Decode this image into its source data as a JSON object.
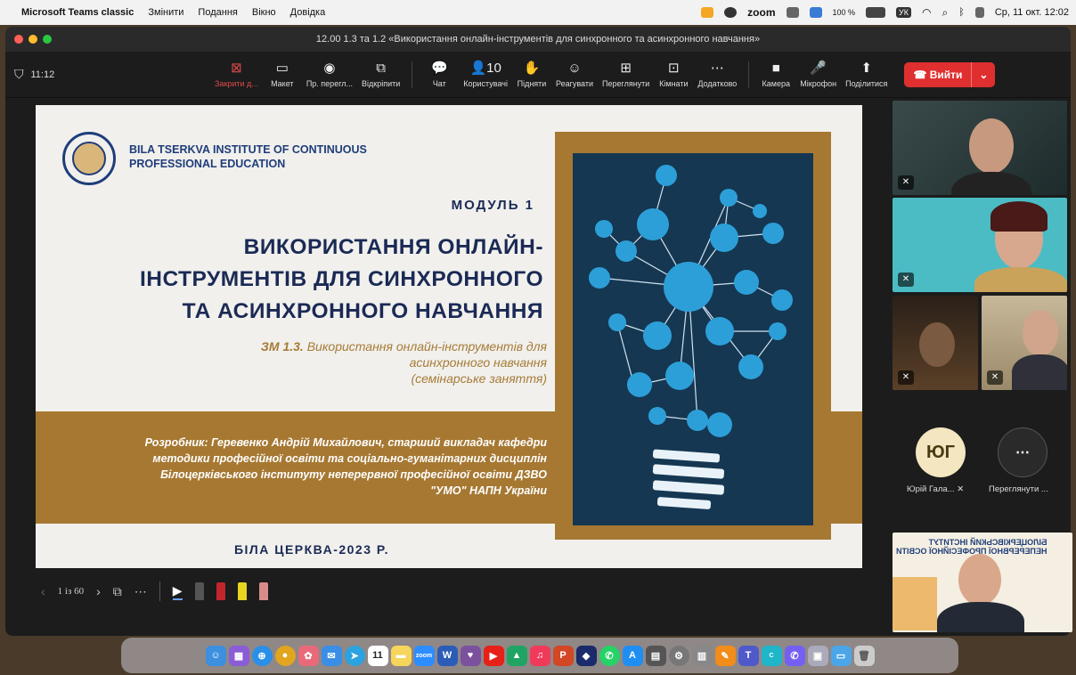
{
  "menubar": {
    "app": "Microsoft Teams classic",
    "items": [
      "Змінити",
      "Подання",
      "Вікно",
      "Довідка"
    ],
    "zoom": "zoom",
    "battery": "100 %",
    "lang": "УК",
    "datetime": "Ср, 11 окт.  12:02"
  },
  "window": {
    "title": "12.00 1.3 та 1.2 «Використання онлайн-інструментів для синхронного та асинхронного навчання»"
  },
  "toolbar": {
    "timer": "11:12",
    "buttons": [
      {
        "name": "stop-presenting",
        "icon": "⊠",
        "label": "Закрити д..."
      },
      {
        "name": "layout",
        "icon": "▭",
        "label": "Макет"
      },
      {
        "name": "presenter-view",
        "icon": "◉",
        "label": "Пр. перегл..."
      },
      {
        "name": "pop-out",
        "icon": "⧉",
        "label": "Відкріпити"
      },
      {
        "name": "chat",
        "icon": "💬",
        "label": "Чат"
      },
      {
        "name": "people",
        "icon": "👤10",
        "label": "Користувачі"
      },
      {
        "name": "raise",
        "icon": "✋",
        "label": "Підняти"
      },
      {
        "name": "react",
        "icon": "☺",
        "label": "Реагувати"
      },
      {
        "name": "view",
        "icon": "⊞",
        "label": "Переглянути"
      },
      {
        "name": "rooms",
        "icon": "⊡",
        "label": "Кімнати"
      },
      {
        "name": "more",
        "icon": "⋯",
        "label": "Додатково"
      },
      {
        "name": "camera",
        "icon": "■",
        "label": "Камера"
      },
      {
        "name": "mic",
        "icon": "🎤",
        "label": "Мікрофон"
      },
      {
        "name": "share",
        "icon": "⬆",
        "label": "Поділитися"
      }
    ],
    "leave": "Вийти"
  },
  "slide": {
    "institute": "BILA TSERKVA INSTITUTE OF CONTINUOUS PROFESSIONAL EDUCATION",
    "module": "МОДУЛЬ 1",
    "title1": "ВИКОРИСТАННЯ ОНЛАЙН-",
    "title2": "ІНСТРУМЕНТІВ ДЛЯ СИНХРОННОГО",
    "title3": "ТА АСИНХРОННОГО НАВЧАННЯ",
    "sub_bold": "ЗМ 1.3.",
    "sub_rest": " Використання онлайн-інструментів для",
    "sub2": "асинхронного навчання",
    "sub3": "(семінарське заняття)",
    "author1": "Розробник: Геревенко Андрій Михайлович, старший викладач кафедри",
    "author2": "методики професійної освіти та соціально-гуманітарних дисциплін",
    "author3": "Білоцерківського інституту неперервної професійної освіти ДЗВО",
    "author4": "\"УМО\" НАПН України",
    "city": "БІЛА ЦЕРКВА-2023 Р."
  },
  "slidecontrols": {
    "page": "1 із 60"
  },
  "participants": {
    "avatar_initials": "ЮГ",
    "avatar_name": "Юрій Гала...",
    "more_label": "Переглянути ...",
    "banner_line1": "БІЛОЦЕРКІВСЬКИЙ ІНСТИТУТ",
    "banner_line2": "НЕПЕРЕРВНОЇ ПРОФЕСІЙНОЇ ОСВІТИ"
  },
  "dock": {
    "zoom_label": "zoom",
    "calendar_day": "11"
  }
}
